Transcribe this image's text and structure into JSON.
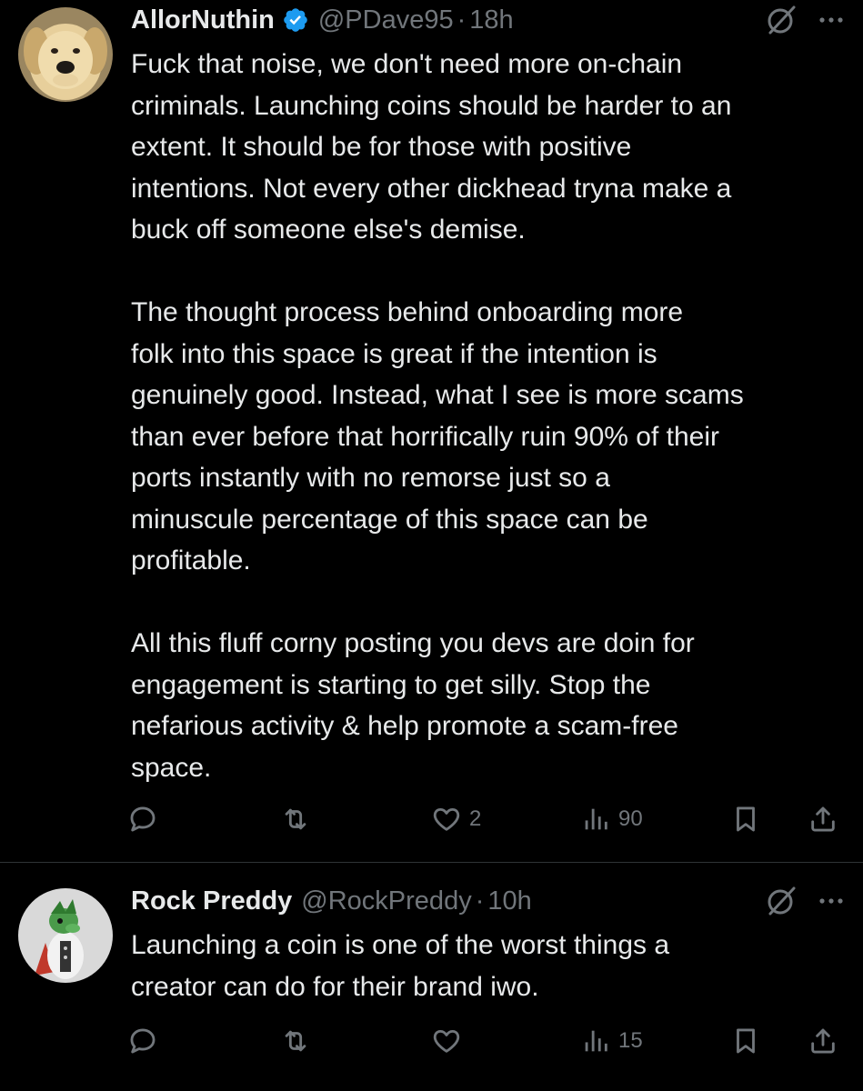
{
  "tweets": [
    {
      "name": "AllorNuthin",
      "verified": true,
      "handle": "@PDave95",
      "separator": "·",
      "time": "18h",
      "text": "Fuck that noise, we don't need more on-chain\ncriminals. Launching coins should be harder to an\nextent. It should be for those with positive\nintentions. Not every other dickhead tryna make a\nbuck off someone else's demise.\n\nThe thought process behind onboarding more\nfolk into this space is great if the intention is\ngenuinely good. Instead, what I see is more scams\nthan ever before that horrifically ruin 90% of their\nports instantly with no remorse just so a\nminuscule percentage of this space can be\nprofitable.\n\nAll this fluff corny posting you devs are doin for\nengagement is starting to get silly. Stop the\nnefarious activity & help promote a scam-free\nspace.",
      "likes": "2",
      "views": "90",
      "avatar_icon": "puppy-avatar"
    },
    {
      "name": "Rock Preddy",
      "verified": false,
      "handle": "@RockPreddy",
      "separator": "·",
      "time": "10h",
      "text": "Launching a coin is one of the worst things a\ncreator can do for their brand iwo.",
      "likes": "",
      "views": "15",
      "avatar_icon": "cartoon-character-avatar"
    }
  ],
  "colors": {
    "background": "#000000",
    "text": "#e7e9ea",
    "secondary": "#71767b",
    "verified": "#1d9bf0",
    "divider": "#2f3336"
  }
}
